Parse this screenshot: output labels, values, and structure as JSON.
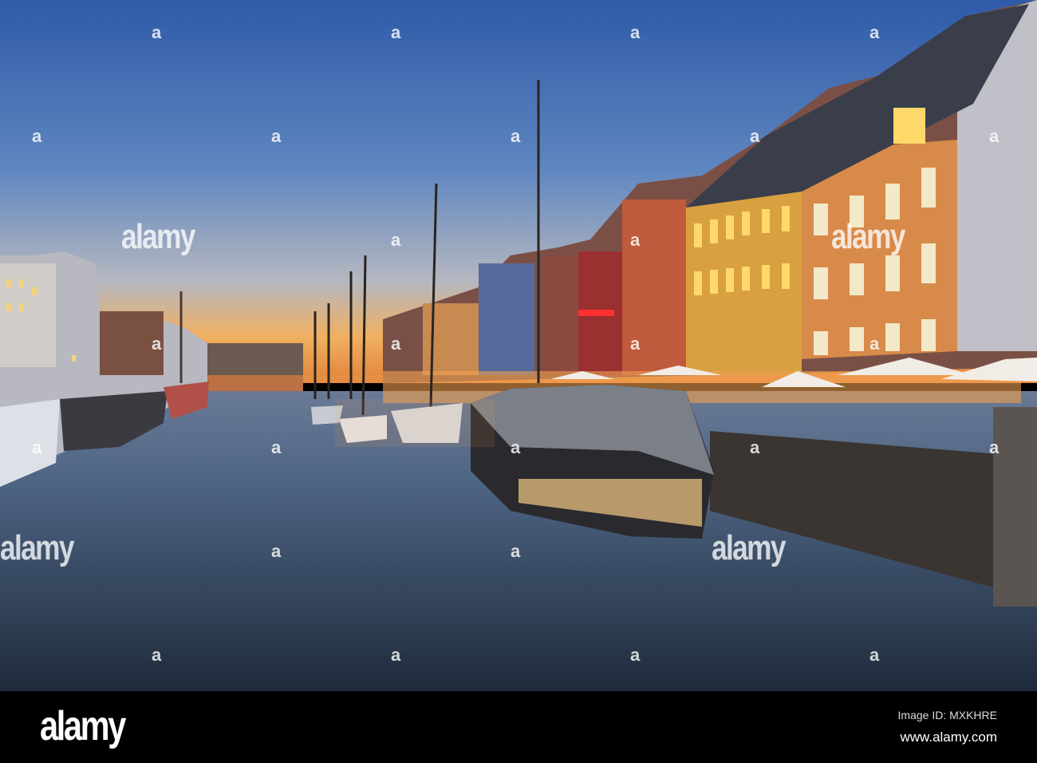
{
  "watermark": {
    "text": "alamy",
    "mark": "a"
  },
  "footer": {
    "logo": "alamy",
    "image_id": "Image ID: MXKHRE",
    "url": "www.alamy.com"
  },
  "colors": {
    "sky_top": "#3a66b0",
    "sky_horizon": "#f0b060",
    "water": "#34465e",
    "bar": "#000000"
  }
}
